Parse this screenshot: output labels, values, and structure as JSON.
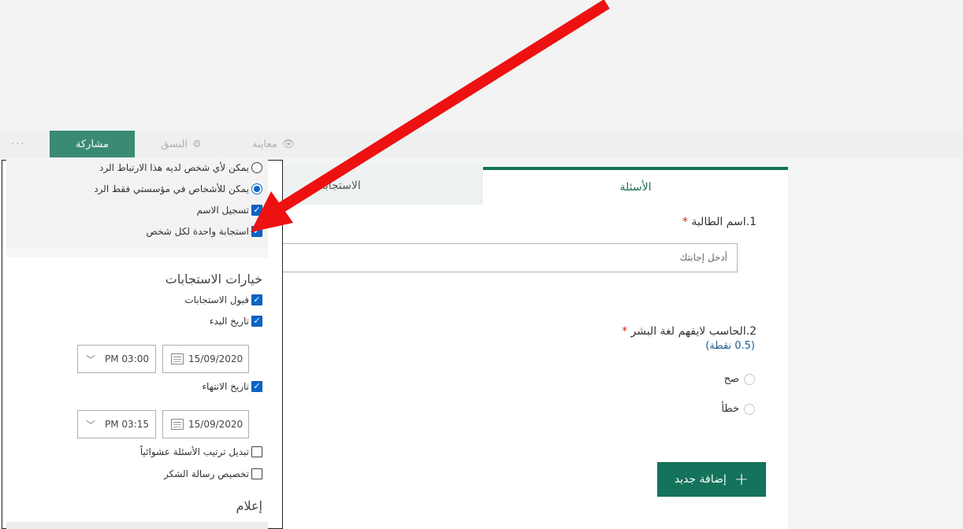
{
  "toolbar": {
    "more_label": "···",
    "share_label": "مشاركة",
    "format_label": "النسق",
    "preview_label": "معاينة"
  },
  "tabs": {
    "questions": "الأسئلة",
    "responses": "الاستجابات"
  },
  "questions": [
    {
      "number": "1.",
      "text": "اسم الطالبة",
      "required_mark": "*",
      "placeholder": "أدخل إجابتك"
    },
    {
      "number": "2.",
      "text": "الحاسب لايفهم لغة البشر",
      "required_mark": "*",
      "points": "(0.5 نقطة)",
      "options": [
        "صح",
        "خطأ"
      ]
    }
  ],
  "add_new_label": "إضافة جديد",
  "settings_panel": {
    "who_can_respond": [
      {
        "label": "يمكن لأي شخص لديه هذا الارتباط الرد",
        "selected": false
      },
      {
        "label": "يمكن للأشخاص في مؤسستي فقط الرد",
        "selected": true
      }
    ],
    "record_name": {
      "label": "تسجيل الاسم",
      "checked": true
    },
    "one_response": {
      "label": "استجابة واحدة لكل شخص",
      "checked": true
    },
    "response_options_title": "خيارات الاستجابات",
    "accept_responses": {
      "label": "قبول الاستجابات",
      "checked": true
    },
    "start_date": {
      "label": "تاريخ البدء",
      "checked": true,
      "date": "15/09/2020",
      "time": "PM 03:00"
    },
    "end_date": {
      "label": "تاريخ الانتهاء",
      "checked": true,
      "date": "15/09/2020",
      "time": "PM 03:15"
    },
    "shuffle_questions": {
      "label": "تبديل ترتيب الأسئلة عشوائياً",
      "checked": false
    },
    "customize_thanks": {
      "label": "تخصيص رسالة الشكر",
      "checked": false
    },
    "notifications_title": "إعلام"
  },
  "colors": {
    "accent": "#14735a",
    "checkbox": "#0b64c8",
    "required": "#d0271d",
    "arrow": "#ee1111"
  }
}
